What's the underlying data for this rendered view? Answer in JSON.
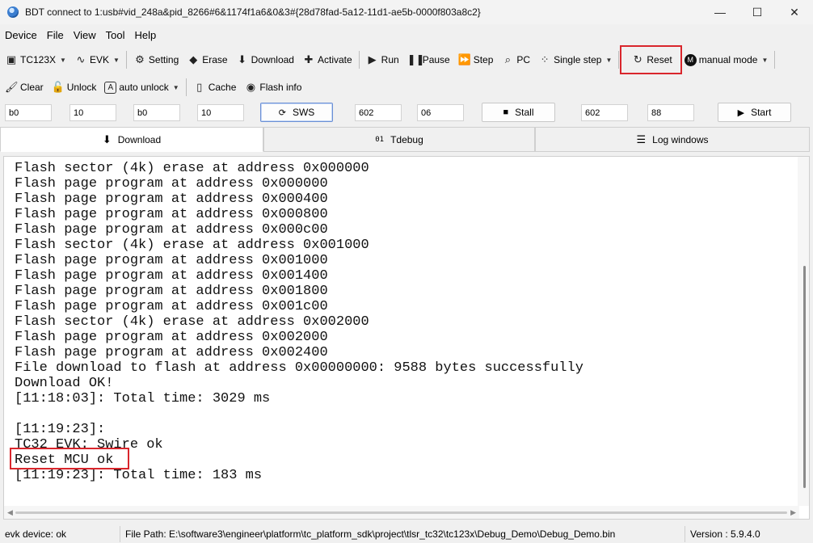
{
  "window": {
    "title": "BDT connect to 1:usb#vid_248a&pid_8266#6&1174f1a6&0&3#{28d78fad-5a12-11d1-ae5b-0000f803a8c2}",
    "controls": [
      "—",
      "☐",
      "✕"
    ]
  },
  "menu": [
    "Device",
    "File",
    "View",
    "Tool",
    "Help"
  ],
  "toolbar1": {
    "chip": "TC123X",
    "board": "EVK",
    "setting": "Setting",
    "erase": "Erase",
    "download": "Download",
    "activate": "Activate",
    "run": "Run",
    "pause": "Pause",
    "step": "Step",
    "pc": "PC",
    "single_step": "Single step",
    "reset": "Reset",
    "manual_mode": "manual mode"
  },
  "toolbar2": {
    "clear": "Clear",
    "unlock": "Unlock",
    "auto_unlock": "auto unlock",
    "cache": "Cache",
    "flash_info": "Flash info"
  },
  "inputs": {
    "f1": "b0",
    "f2": "10",
    "f3": "b0",
    "f4": "10",
    "sws": "SWS",
    "f5": "602",
    "f6": "06",
    "stall": "Stall",
    "f7": "602",
    "f8": "88",
    "start": "Start"
  },
  "tabs": [
    "Download",
    "Tdebug",
    "Log windows"
  ],
  "log": [
    "Flash sector (4k) erase at address 0x000000",
    "Flash page program at address 0x000000",
    "Flash page program at address 0x000400",
    "Flash page program at address 0x000800",
    "Flash page program at address 0x000c00",
    "Flash sector (4k) erase at address 0x001000",
    "Flash page program at address 0x001000",
    "Flash page program at address 0x001400",
    "Flash page program at address 0x001800",
    "Flash page program at address 0x001c00",
    "Flash sector (4k) erase at address 0x002000",
    "Flash page program at address 0x002000",
    "Flash page program at address 0x002400",
    "File download to flash at address 0x00000000: 9588 bytes successfully",
    "Download OK!",
    "[11:18:03]: Total time: 3029 ms",
    "",
    "[11:19:23]:",
    "TC32 EVK: Swire ok",
    "Reset MCU ok",
    "[11:19:23]: Total time: 183 ms"
  ],
  "status": {
    "device": "evk device: ok",
    "file_path": "File Path:  E:\\software3\\engineer\\platform\\tc_platform_sdk\\project\\tlsr_tc32\\tc123x\\Debug_Demo\\Debug_Demo.bin",
    "version": "Version : 5.9.4.0"
  },
  "colors": {
    "highlight": "#d9262c",
    "log_bg": "#ffffff"
  }
}
